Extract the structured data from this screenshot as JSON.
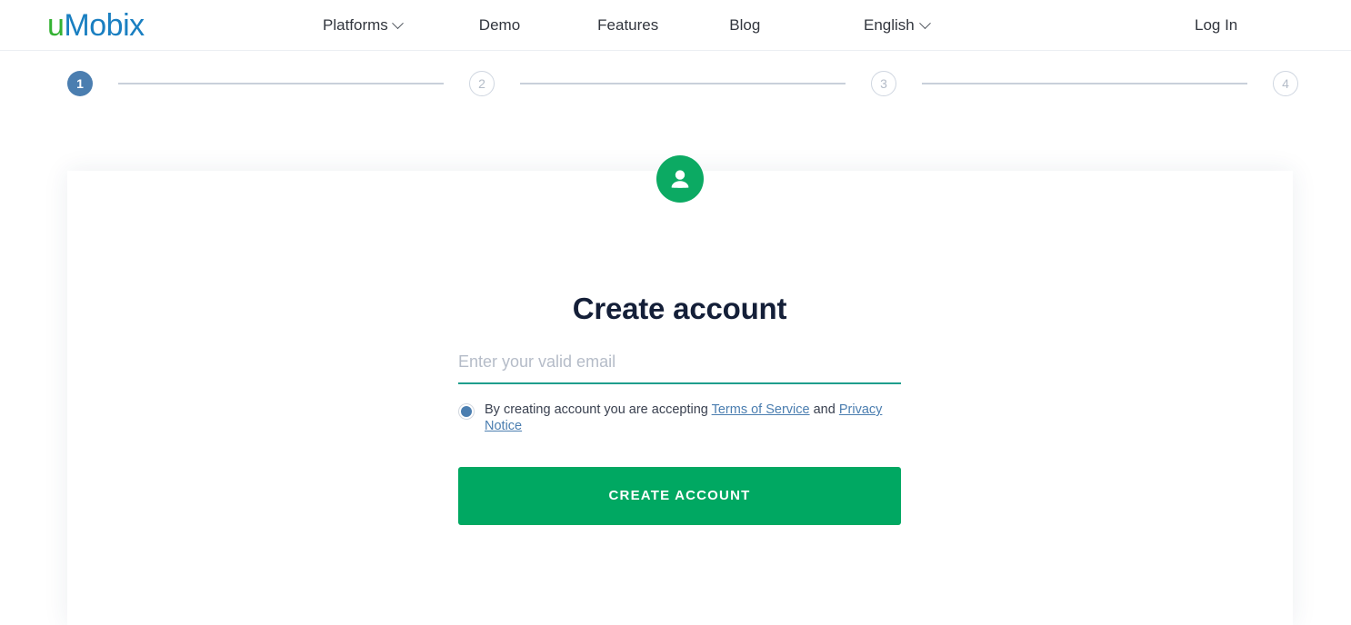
{
  "brand": {
    "logo_first": "u",
    "logo_rest": "Mobix",
    "color_green": "#34b233",
    "color_blue": "#1a7fc1"
  },
  "header": {
    "nav": [
      {
        "label": "Platforms",
        "has_chevron": true
      },
      {
        "label": "Demo",
        "has_chevron": false
      },
      {
        "label": "Features",
        "has_chevron": false
      },
      {
        "label": "Blog",
        "has_chevron": false
      }
    ],
    "language": "English",
    "login_label": "Log In"
  },
  "stepper": {
    "steps": [
      {
        "number": "1",
        "state": "active"
      },
      {
        "number": "2",
        "state": "idle"
      },
      {
        "number": "3",
        "state": "idle"
      },
      {
        "number": "4",
        "state": "idle"
      }
    ],
    "active_color": "#4b7eb0",
    "idle_color": "#b4bcc8"
  },
  "form": {
    "avatar_icon": "user-icon",
    "avatar_color": "#0caa63",
    "title": "Create account",
    "email": {
      "value": "",
      "placeholder": "Enter your valid email",
      "underline_color": "#1f9e8d"
    },
    "consent": {
      "checked": true,
      "text_before": "By creating account you are accepting ",
      "link_terms": "Terms of Service",
      "text_middle": " and ",
      "link_privacy": "Privacy Notice",
      "link_color": "#4b7eb0"
    },
    "submit_label": "CREATE ACCOUNT",
    "submit_color": "#00a862"
  }
}
